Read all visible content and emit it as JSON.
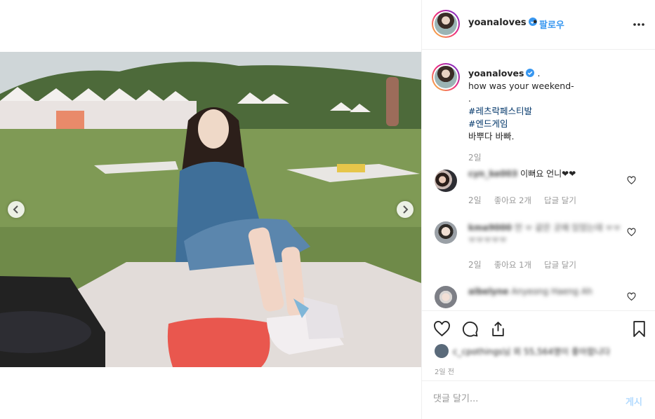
{
  "post": {
    "username": "yoanaloves",
    "header_separator": "•",
    "follow_label": "팔로우",
    "caption_suffix": ".",
    "caption_lines": [
      "how was your weekend-",
      "."
    ],
    "hashtags": [
      "#레츠락페스티발",
      "#엔드게임"
    ],
    "caption_last": "바뿌다 바빠.",
    "caption_time": "2일",
    "verified_color": "#3897f0",
    "follow_color": "#3897f0"
  },
  "comments": [
    {
      "user": "cyn_ke003",
      "text": "이뻐요 언니❤❤",
      "time": "2일",
      "likes": "좋아요 2개",
      "reply": "답글 달기"
    },
    {
      "user": "kma9000",
      "text": "언 ㅠ 같은 곳에 있었는데 ㅠㅠㅠㅠㅠㅠㅠ",
      "time": "2일",
      "likes": "좋아요 1개",
      "reply": "답글 달기"
    },
    {
      "user": "aibelyne",
      "text": "Anyeong Haeng Ah"
    }
  ],
  "actions": {
    "icons": [
      "heart-icon",
      "comment-icon",
      "share-icon",
      "bookmark-icon"
    ],
    "likes_text": "c_cpothings님 외 55,564명이 좋아합니다",
    "post_time": "2일 전"
  },
  "comment_box": {
    "placeholder": "댓글 달기...",
    "post_label": "게시"
  }
}
